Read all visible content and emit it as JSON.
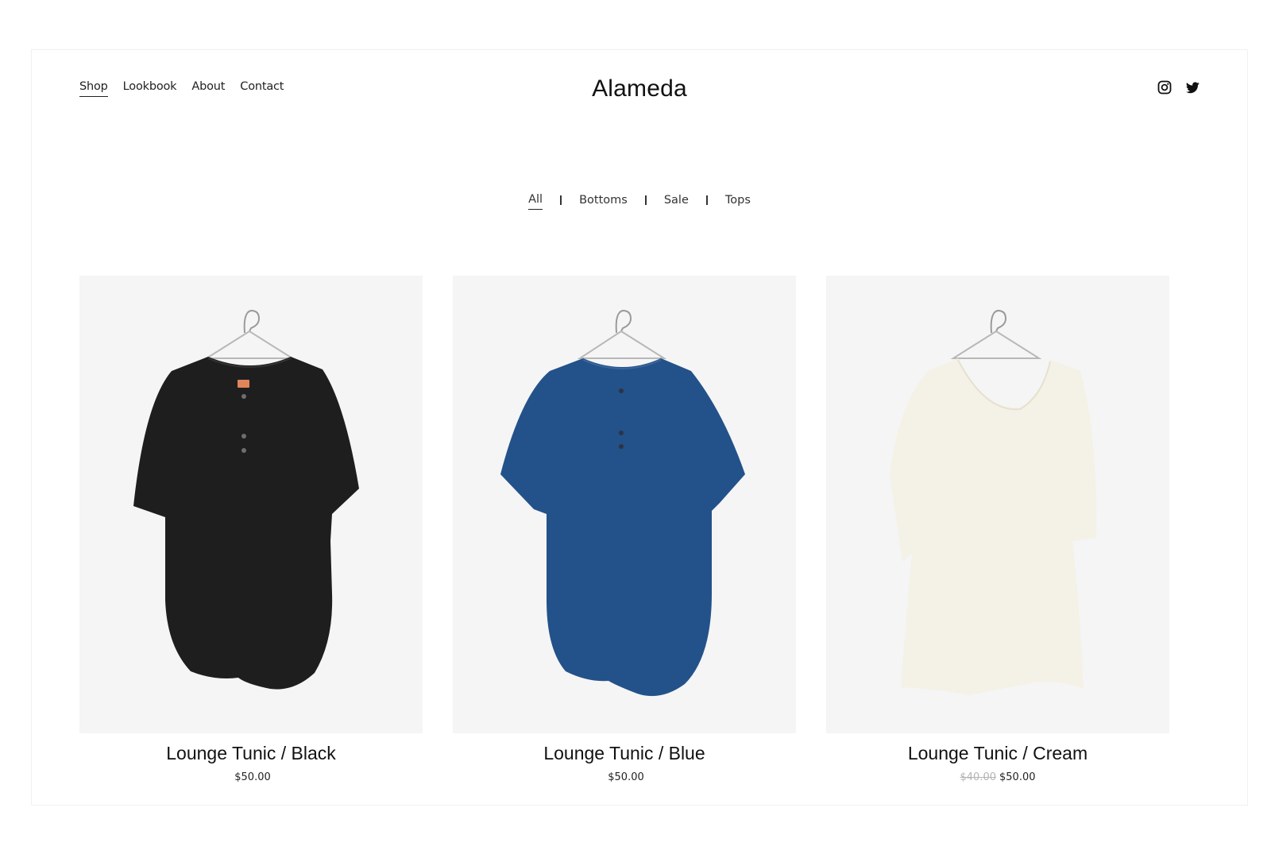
{
  "site": {
    "name": "Alameda"
  },
  "nav": {
    "items": [
      {
        "label": "Shop",
        "active": true
      },
      {
        "label": "Lookbook"
      },
      {
        "label": "About"
      },
      {
        "label": "Contact"
      }
    ]
  },
  "social": {
    "icons": [
      "instagram-icon",
      "twitter-icon"
    ]
  },
  "filters": {
    "items": [
      {
        "label": "All",
        "active": true
      },
      {
        "label": "Bottoms"
      },
      {
        "label": "Sale"
      },
      {
        "label": "Tops"
      }
    ]
  },
  "products": [
    {
      "title": "Lounge Tunic / Black",
      "price": "$50.00",
      "old_price": "",
      "color": "#1e1e1f"
    },
    {
      "title": "Lounge Tunic / Blue",
      "price": "$50.00",
      "old_price": "",
      "color": "#23528a"
    },
    {
      "title": "Lounge Tunic / Cream",
      "price": "$50.00",
      "old_price": "$40.00",
      "color": "#f4f1e6"
    }
  ]
}
